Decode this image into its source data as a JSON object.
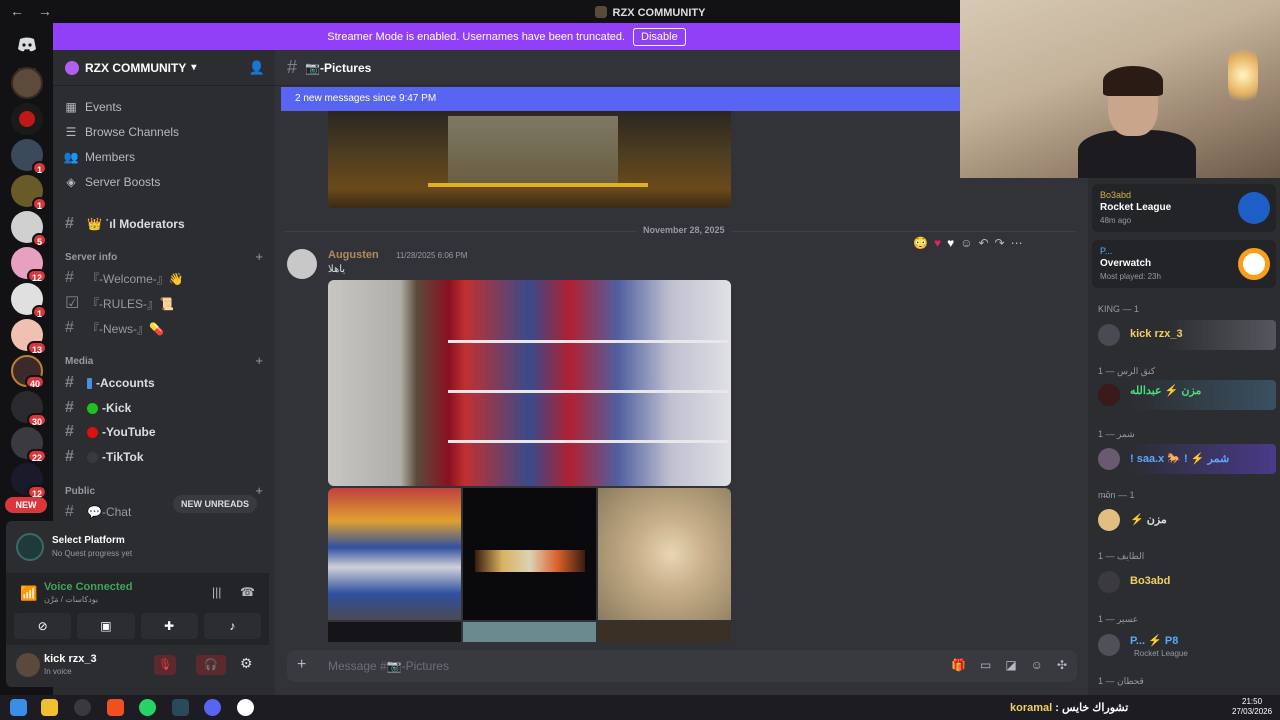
{
  "window": {
    "title": "RZX COMMUNITY",
    "back": "←",
    "forward": "→"
  },
  "rail": {
    "dm_icon": "discord-icon",
    "badges": [
      "1",
      "1",
      "5",
      "12",
      "1",
      "13",
      "40",
      "30",
      "22",
      "12"
    ],
    "new_label": "NEW"
  },
  "banner": {
    "text": "Streamer Mode is enabled. Usernames have been truncated.",
    "button": "Disable",
    "color": "#9140f8"
  },
  "sidebar": {
    "server_name": "RZX COMMUNITY",
    "items": [
      {
        "label": "Events",
        "icon": "calendar-icon"
      },
      {
        "label": "Browse Channels",
        "icon": "browse-icon"
      },
      {
        "label": "Members",
        "icon": "members-icon"
      },
      {
        "label": "Server Boosts",
        "icon": "boost-icon"
      }
    ],
    "moderators": "👑 ˙ıl Moderators",
    "cat_server_info": "Server info",
    "cat_media": "Media",
    "cat_public": "Public",
    "channels_info": [
      "『-Welcome-』👋",
      "『-RULES-』📜",
      "『-News-』💊"
    ],
    "channels_media": [
      "-Accounts",
      "-Kick",
      "-YouTube",
      "-TikTok"
    ],
    "channel_chat": "💬-Chat",
    "new_unreads": "NEW UNREADS"
  },
  "panel": {
    "quest_title": "Select Platform",
    "quest_sub": "No Quest progress yet",
    "voice_title": "Voice Connected",
    "voice_sub": "بودكاسات / مَرَّن",
    "user_name": "kick rzx_3",
    "user_status": "In voice"
  },
  "chat": {
    "channel": "📷-Pictures",
    "new_messages": "2 new messages since 9:47 PM",
    "date_divider": "November 28, 2025",
    "author": "Augusten",
    "timestamp": "11/28/2025 6:06 PM",
    "message": "ياهلا",
    "placeholder": "Message #📷-Pictures"
  },
  "members": {
    "activities": [
      {
        "name": "Bo3abd",
        "game": "Rocket League",
        "time": "48m ago"
      },
      {
        "name": "P...",
        "game": "Overwatch",
        "time": "Most played: 23h"
      }
    ],
    "groups": [
      {
        "header": "KING — 1",
        "member": "kick rzx_3",
        "color": "#f0d060"
      },
      {
        "header": "كنق الرس — 1",
        "member": "مزن ⚡ عبدالله",
        "color": "#4fdc7c"
      },
      {
        "header": "شمر — 1",
        "member": "! saa.x 🐎 ! ⚡ شمر",
        "color": "#5aa8ff"
      },
      {
        "header": "m̶ōn — 1",
        "member": "⚡ مزن",
        "color": "#dbdee1"
      },
      {
        "header": "الطايف — 1",
        "member": "Bo3abd",
        "color": "#f0d060"
      },
      {
        "header": "عسير — 1",
        "member": "P... ⚡ P8",
        "color": "#5aa8ff"
      }
    ],
    "last_group": "قحطان — 1",
    "sub_rl": "Rocket League"
  },
  "taskbar": {
    "ticker_name": "koramal",
    "ticker_text": ": تشوراك خايس",
    "time": "21:50",
    "date": "27/03/2026"
  }
}
